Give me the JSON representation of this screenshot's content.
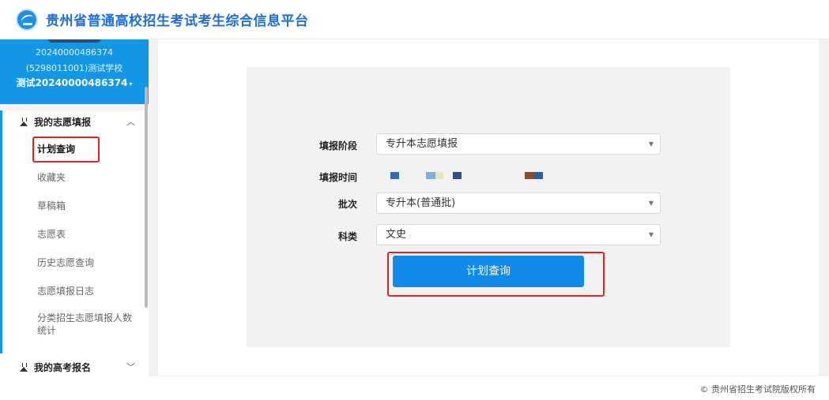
{
  "header": {
    "title": "贵州省普通高校招生考试考生综合信息平台",
    "logo_icon": "platform-logo-icon"
  },
  "sidebar": {
    "profile": {
      "id": "20240000486374",
      "school": "(5298011001)测试学校",
      "username": "测试20240000486374",
      "caret": "▾"
    },
    "groups": [
      {
        "label": "我的志愿填报",
        "icon": "flask-icon",
        "expanded": true,
        "chevron": "︿",
        "items": [
          {
            "label": "计划查询",
            "active": true
          },
          {
            "label": "收藏夹"
          },
          {
            "label": "草稿箱"
          },
          {
            "label": "志愿表"
          },
          {
            "label": "历史志愿查询"
          },
          {
            "label": "志愿填报日志"
          },
          {
            "label": "分类招生志愿填报人数统计"
          }
        ]
      },
      {
        "label": "我的高考报名",
        "icon": "flask-icon",
        "expanded": false,
        "chevron": "﹀"
      }
    ]
  },
  "form": {
    "stage": {
      "label": "填报阶段",
      "value": "专升本志愿填报"
    },
    "time": {
      "label": "填报时间",
      "swatch_colors": [
        "#2f6db3",
        "#7ab1e3",
        "#e9e6b6",
        "#2e4f8f",
        "#8b4a2b",
        "#2e5d9f"
      ]
    },
    "batch": {
      "label": "批次",
      "value": "专升本(普通批)"
    },
    "subject": {
      "label": "科类",
      "value": "文史"
    },
    "query_button": "计划查询",
    "select_arrow": "▼"
  },
  "footer": {
    "copyright": "© 贵州省招生考试院版权所有"
  },
  "colors": {
    "accent": "#1296e6",
    "button": "#108bea",
    "highlight": "#e02424"
  }
}
